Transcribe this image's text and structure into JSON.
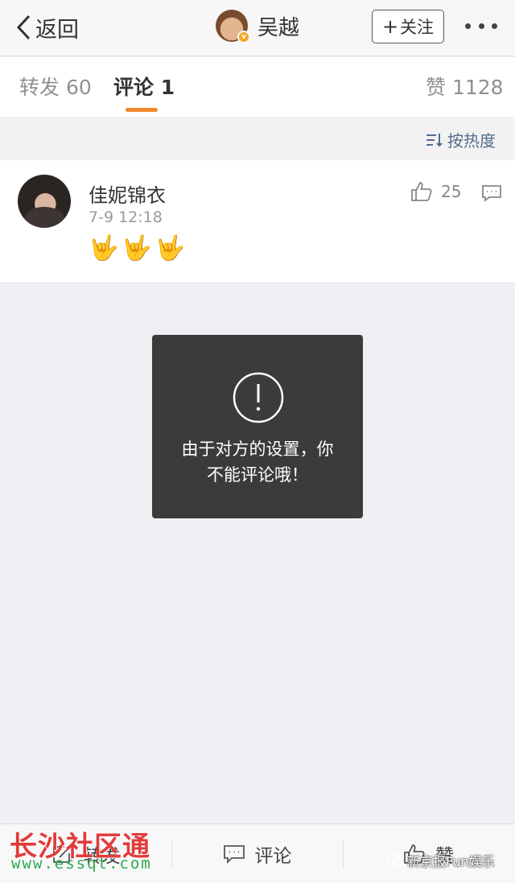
{
  "navbar": {
    "back_label": "返回",
    "user_name": "吴越",
    "follow_label": "关注",
    "follow_plus": "+"
  },
  "tabs": {
    "repost": "转发 60",
    "comment": "评论 1",
    "likes": "赞 1128"
  },
  "sort": {
    "label": "按热度"
  },
  "comment": {
    "author": "佳妮锦衣",
    "time": "7-9 12:18",
    "emoji": [
      "🤟",
      "🤟",
      "🤟"
    ],
    "like_count": "25"
  },
  "toast": {
    "line1": "由于对方的设置，你",
    "line2": "不能评论哦！"
  },
  "bottombar": {
    "repost": "转发",
    "comment": "评论",
    "like": "赞"
  },
  "watermarks": {
    "left_title": "长沙社区通",
    "left_url": "www.essqt.com",
    "right": "新京报Fun娱乐"
  },
  "colors": {
    "accent": "#f08a2e",
    "link": "#536d8f",
    "toast_bg": "#3b3b3b"
  }
}
